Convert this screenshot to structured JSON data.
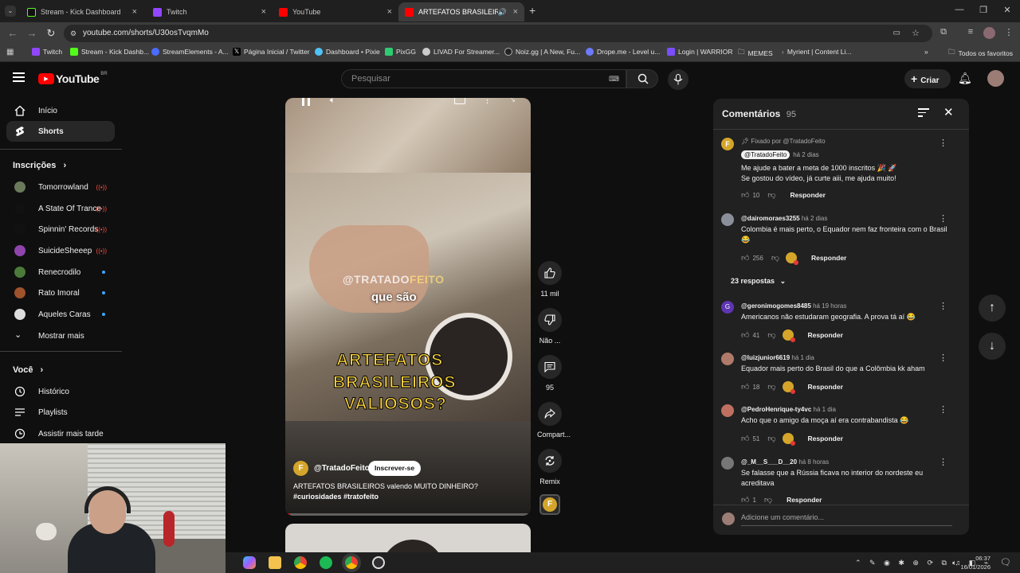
{
  "browser": {
    "tabs": [
      {
        "label": "Stream - Kick Dashboard",
        "color": "#53fc18"
      },
      {
        "label": "Twitch",
        "color": "#9146ff"
      },
      {
        "label": "YouTube",
        "color": "#ff0000"
      },
      {
        "label": "ARTEFATOS BRASILEIROS va",
        "color": "#ff0000"
      }
    ],
    "url": "youtube.com/shorts/U30osTvqmMo",
    "bookmarks": [
      {
        "label": "Twitch",
        "color": "#9146ff"
      },
      {
        "label": "Stream - Kick Dashb...",
        "color": "#53fc18"
      },
      {
        "label": "StreamElements - A...",
        "color": "#4b6cff"
      },
      {
        "label": "Página Inicial / Twitter",
        "color": "#ffffff"
      },
      {
        "label": "Dashboard • Pixie",
        "color": "#4fc3f7"
      },
      {
        "label": "PixGG",
        "color": "#2ecc71"
      },
      {
        "label": "LIVAD For Streamer...",
        "color": "#cccccc"
      },
      {
        "label": "Noiz.gg | A New, Fu...",
        "color": "#222222"
      },
      {
        "label": "Drope.me - Level u...",
        "color": "#6c7bff"
      },
      {
        "label": "Login | WARRIOR",
        "color": "#7b4dff"
      },
      {
        "label": "MEMES",
        "color": "#cccccc"
      },
      {
        "label": "Myrient | Content Li...",
        "color": "#888888"
      }
    ],
    "all_bookmarks": "Todos os favoritos"
  },
  "header": {
    "logo": "YouTube",
    "logo_region": "BR",
    "search_placeholder": "Pesquisar",
    "create_label": "Criar"
  },
  "sidebar": {
    "main": [
      {
        "label": "Início",
        "icon": "home-icon"
      },
      {
        "label": "Shorts",
        "icon": "shorts-icon"
      }
    ],
    "subscriptions_title": "Inscrições",
    "subscriptions": [
      {
        "label": "Tomorrowland",
        "color": "#6b7a5a",
        "status": "live"
      },
      {
        "label": "A State Of Trance",
        "color": "#111111",
        "status": "live"
      },
      {
        "label": "Spinnin' Records",
        "color": "#111111",
        "status": "live"
      },
      {
        "label": "SuicideSheeep",
        "color": "#8e44ad",
        "status": "live"
      },
      {
        "label": "Renecrodilo",
        "color": "#4b7a3a",
        "status": "new"
      },
      {
        "label": "Rato Imoral",
        "color": "#a0522d",
        "status": "new"
      },
      {
        "label": "Aqueles Caras",
        "color": "#dddddd",
        "status": "new"
      }
    ],
    "show_more": "Mostrar mais",
    "you_title": "Você",
    "you_items": [
      {
        "label": "Histórico",
        "icon": "history-icon"
      },
      {
        "label": "Playlists",
        "icon": "playlists-icon"
      },
      {
        "label": "Assistir mais tarde",
        "icon": "watch-later-icon"
      }
    ]
  },
  "video": {
    "overlay_brand_1": "@TRATADO",
    "overlay_brand_2": "FEITO",
    "caption_small": "que são",
    "caption_big": [
      "ARTEFATOS",
      "BRASILEIROS",
      "VALIOSOS?"
    ],
    "channel": "@TratadoFeito",
    "subscribe": "Inscrever-se",
    "description": "ARTEFATOS BRASILEIROS valendo MUITO DINHEIRO?",
    "hashtags": [
      "#curiosidades",
      "#tratofeito"
    ],
    "progress_fraction": 0.02
  },
  "actions": [
    {
      "label": "11 mil",
      "icon": "like-icon"
    },
    {
      "label": "Não ...",
      "icon": "dislike-icon"
    },
    {
      "label": "95",
      "icon": "comment-icon"
    },
    {
      "label": "Compart...",
      "icon": "share-icon"
    },
    {
      "label": "Remix",
      "icon": "remix-icon"
    }
  ],
  "comments_panel": {
    "title": "Comentários",
    "count": "95",
    "add_placeholder": "Adicione um comentário...",
    "items": [
      {
        "pinned": "Fixado por @TratadoFeito",
        "author": "@TratadoFeito",
        "time": "há 2 dias",
        "text": [
          "Me ajude a bater a meta de 1000 inscritos 🎉 🚀",
          "Se gostou do vídeo, já curte aiii, me ajuda muito!"
        ],
        "likes": "10",
        "reply": "Responder",
        "avatar_color": "#d4a52a"
      },
      {
        "author": "@dairomoraes3255",
        "time": "há 2 dias",
        "text": [
          "Colombia é mais perto, o Equador nem faz fronteira com o Brasil",
          "😂"
        ],
        "likes": "256",
        "reply": "Responder",
        "replies": "23 respostas",
        "avatar_color": "#8a8f99"
      },
      {
        "author": "@geronimogomes8485",
        "time": "há 19 horas",
        "text": [
          "Americanos não estudaram geografia. A prova tá aí 😂"
        ],
        "likes": "41",
        "reply": "Responder",
        "avatar_letter": "G",
        "avatar_color": "#5e35b1"
      },
      {
        "author": "@luizjunior6619",
        "time": "há 1 dia",
        "text": [
          "Equador mais perto do Brasil do que a Colômbia kk aham"
        ],
        "likes": "18",
        "reply": "Responder",
        "avatar_color": "#b07a6a"
      },
      {
        "author": "@PedroHenrique-ty4vc",
        "time": "há 1 dia",
        "text": [
          "Acho que o amigo da moça aí era contrabandista 😂"
        ],
        "likes": "51",
        "reply": "Responder",
        "avatar_color": "#c07060"
      },
      {
        "author": "@_M__S___D__20",
        "time": "há 8 horas",
        "text": [
          "Se falasse que a Rússia ficava no interior do nordeste eu",
          "acreditava"
        ],
        "likes": "1",
        "reply": "Responder",
        "avatar_color": "#777777"
      }
    ]
  },
  "taskbar": {
    "time": "06:37",
    "date": "16/01/2026"
  }
}
